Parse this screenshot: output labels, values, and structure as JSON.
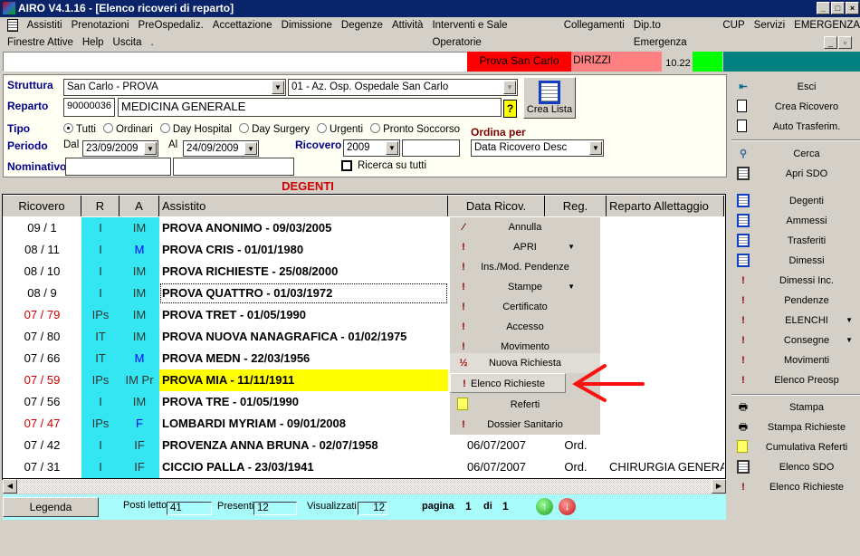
{
  "window": {
    "title": "AIRO V4.1.16 - [Elenco ricoveri di reparto]"
  },
  "menu": [
    "Assistiti",
    "Prenotazioni",
    "PreOspedaliz.",
    "Accettazione",
    "Dimissione",
    "Degenze",
    "Attività",
    "Interventi e Sale Operatorie",
    "Collegamenti",
    "Dip.to Emergenza",
    "CUP",
    "Servizi",
    "EMERGENZA"
  ],
  "menu2": [
    "Finestre Attive",
    "Help",
    "Uscita",
    "."
  ],
  "status": {
    "site": "Prova San Carlo",
    "user": "DIRIZZI",
    "time": "10.22",
    "colors": {
      "site": "#ff0000",
      "user": "#ff8080",
      "ok": "#00ff00",
      "bar": "#008080"
    }
  },
  "form": {
    "struttura_label": "Struttura",
    "struttura": "San Carlo - PROVA",
    "azienda": "01 - Az. Osp. Ospedale San Carlo",
    "reparto_label": "Reparto",
    "reparto_code": "90000036",
    "reparto": "MEDICINA GENERALE",
    "crea_lista": "Crea Lista",
    "tipo_label": "Tipo",
    "tipo_options": [
      "Tutti",
      "Ordinari",
      "Day Hospital",
      "Day Surgery",
      "Urgenti",
      "Pronto Soccorso"
    ],
    "tipo_selected": "Tutti",
    "periodo_label": "Periodo",
    "dal_label": "Dal",
    "dal": "23/09/2009",
    "al_label": "Al",
    "al": "24/09/2009",
    "ricovero_label": "Ricovero",
    "ricovero_year": "2009",
    "ricovero_num": "",
    "ordina_label": "Ordina per",
    "ordina": "Data Ricovero Desc",
    "nominativo_label": "Nominativo",
    "nominativo1": "",
    "nominativo2": "",
    "ricerca_label": "Ricerca su tutti",
    "ricerca_checked": false
  },
  "section_title": "DEGENTI",
  "table": {
    "columns": [
      "Ricovero",
      "R",
      "A",
      "Assistito",
      "Data Ricov.",
      "Reg.",
      "Reparto Allettaggio"
    ],
    "rows": [
      {
        "ricovero": "09 / 1",
        "r": "I",
        "a": "IM",
        "assistito": "PROVA ANONIMO - 09/03/2005",
        "data": "",
        "reg": "",
        "reparto": ""
      },
      {
        "ricovero": "08 / 11",
        "r": "I",
        "a": "M",
        "assistito": "PROVA CRIS - 01/01/1980",
        "data": "",
        "reg": "",
        "reparto": ""
      },
      {
        "ricovero": "08 / 10",
        "r": "I",
        "a": "IM",
        "assistito": "PROVA RICHIESTE - 25/08/2000",
        "data": "",
        "reg": "",
        "reparto": ""
      },
      {
        "ricovero": "08 / 9",
        "r": "I",
        "a": "IM",
        "assistito": "PROVA QUATTRO - 01/03/1972",
        "data": "",
        "reg": "",
        "reparto": ""
      },
      {
        "ricovero": "07 / 79",
        "r": "IPs",
        "a": "IM",
        "assistito": "PROVA TRET - 01/05/1990",
        "data": "",
        "reg": "",
        "reparto": ""
      },
      {
        "ricovero": "07 / 80",
        "r": "IT",
        "a": "IM",
        "assistito": "PROVA NUOVA NANAGRAFICA - 01/02/1975",
        "data": "",
        "reg": "",
        "reparto": ""
      },
      {
        "ricovero": "07 / 66",
        "r": "IT",
        "a": "M",
        "assistito": "PROVA MEDN - 22/03/1956",
        "data": "",
        "reg": "",
        "reparto": ""
      },
      {
        "ricovero": "07 / 59",
        "r": "IPs",
        "a": "IM Pr",
        "assistito": "PROVA MIA - 11/11/1911",
        "data": "",
        "reg": "",
        "reparto": ""
      },
      {
        "ricovero": "07 / 56",
        "r": "I",
        "a": "IM",
        "assistito": "PROVA TRE - 01/05/1990",
        "data": "",
        "reg": "",
        "reparto": ""
      },
      {
        "ricovero": "07 / 47",
        "r": "IPs",
        "a": "F",
        "assistito": "LOMBARDI MYRIAM - 09/01/2008",
        "data": "",
        "reg": "",
        "reparto": ""
      },
      {
        "ricovero": "07 / 42",
        "r": "I",
        "a": "IF",
        "assistito": "PROVENZA ANNA BRUNA - 02/07/1958",
        "data": "06/07/2007",
        "reg": "Ord.",
        "reparto": ""
      },
      {
        "ricovero": "07 / 31",
        "r": "I",
        "a": "IF",
        "assistito": "CICCIO PALLA - 23/03/1941",
        "data": "06/07/2007",
        "reg": "Ord.",
        "reparto": "CHIRURGIA GENERALE"
      }
    ],
    "red_rows": [
      4,
      7,
      9
    ],
    "blue_a_rows": [
      1,
      6,
      9
    ],
    "highlight_row": 7,
    "focus_row": 3
  },
  "context_menu": [
    {
      "label": "Annulla",
      "icon": "wand-icon"
    },
    {
      "label": "APRI",
      "icon": "exclamation-icon",
      "submenu": true
    },
    {
      "label": "Ins./Mod. Pendenze",
      "icon": "exclamation-icon"
    },
    {
      "label": "Stampe",
      "icon": "exclamation-icon",
      "submenu": true
    },
    {
      "label": "Certificato",
      "icon": "exclamation-icon"
    },
    {
      "label": "Accesso",
      "icon": "exclamation-icon"
    },
    {
      "label": "Movimento",
      "icon": "exclamation-icon"
    },
    {
      "label": "Nuova Richiesta",
      "icon": "numbers-icon"
    },
    {
      "label": "Elenco Richieste",
      "icon": "exclamation-icon",
      "hover": true
    },
    {
      "label": "Referti",
      "icon": "report-icon"
    },
    {
      "label": "Dossier Sanitario",
      "icon": "exclamation-icon"
    }
  ],
  "right_panel": [
    {
      "label": "Esci",
      "icon": "exit-icon"
    },
    {
      "label": "Crea Ricovero",
      "icon": "document-icon"
    },
    {
      "label": "Auto Trasferim.",
      "icon": "document-icon"
    },
    {
      "label": "Cerca",
      "icon": "search-icon"
    },
    {
      "label": "Apri SDO",
      "icon": "list-icon"
    },
    {
      "label": "Degenti",
      "icon": "grid-icon"
    },
    {
      "label": "Ammessi",
      "icon": "grid-icon"
    },
    {
      "label": "Trasferiti",
      "icon": "grid-icon"
    },
    {
      "label": "Dimessi",
      "icon": "grid-icon"
    },
    {
      "label": "Dimessi Inc.",
      "icon": "exclamation-icon"
    },
    {
      "label": "Pendenze",
      "icon": "exclamation-icon"
    },
    {
      "label": "ELENCHI",
      "icon": "exclamation-icon",
      "submenu": true
    },
    {
      "label": "Consegne",
      "icon": "exclamation-icon",
      "submenu": true
    },
    {
      "label": "Movimenti",
      "icon": "exclamation-icon"
    },
    {
      "label": "Elenco Preosp",
      "icon": "exclamation-icon"
    },
    {
      "label": "Stampa",
      "icon": "printer-icon"
    },
    {
      "label": "Stampa Richieste",
      "icon": "printer-icon"
    },
    {
      "label": "Cumulativa Referti",
      "icon": "report-icon"
    },
    {
      "label": "Elenco SDO",
      "icon": "list-icon"
    },
    {
      "label": "Elenco Richieste",
      "icon": "exclamation-icon"
    }
  ],
  "footer": {
    "legenda": "Legenda",
    "posti_label": "Posti letto",
    "posti": "41",
    "presenti_label": "Presenti",
    "presenti": "12",
    "visualizzati_label": "Visualizzati",
    "visualizzati": "12",
    "pagina_label": "pagina",
    "pagina": "1",
    "di_label": "di",
    "di": "1"
  }
}
